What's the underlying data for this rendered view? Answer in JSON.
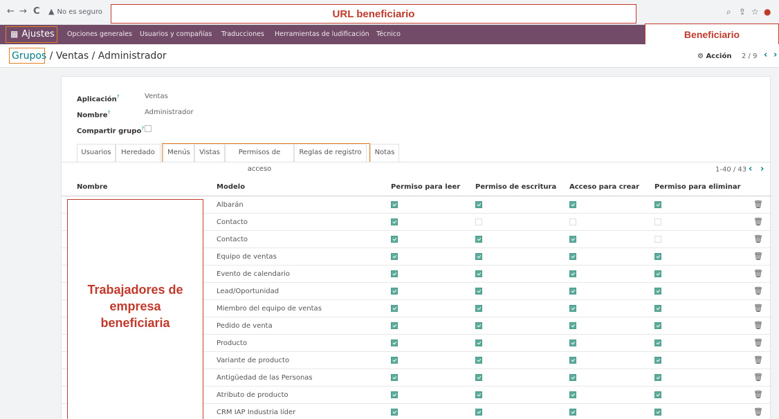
{
  "browser": {
    "back_icon": "←",
    "forward_icon": "→",
    "reload_icon": "C",
    "insecure_icon": "▲",
    "insecure_text": "No es seguro"
  },
  "annotations": {
    "url_label": "URL beneficiario",
    "beneficiary_label": "Beneficiario",
    "workers_label_line1": "Trabajadores de",
    "workers_label_line2": "empresa",
    "workers_label_line3": "beneficiaria",
    "highlight_color": "#c0392b",
    "focus_color": "#e67e22"
  },
  "navbar": {
    "app_icon": "▦",
    "app_name": "Ajustes",
    "menu": [
      "Opciones generales",
      "Usuarios y compañías",
      "Traducciones",
      "Herramientas de ludificación",
      "Técnico"
    ],
    "brand_color": "#714b67"
  },
  "breadcrumb": {
    "root": "Grupos",
    "rest": " / Ventas / Administrador"
  },
  "control": {
    "action_label": "⚙ Acción",
    "pager": "2 / 9",
    "prev": "‹",
    "next": "›"
  },
  "form": {
    "app_label": "Aplicación",
    "app_value": "Ventas",
    "name_label": "Nombre",
    "name_value": "Administrador",
    "share_label": "Compartir grupo",
    "help_mark": "?"
  },
  "tabs": [
    "Usuarios",
    "Heredado",
    "Menús",
    "Vistas",
    "Permisos de acceso",
    "Reglas de registro",
    "Notas"
  ],
  "list": {
    "pager": "1-40 / 43",
    "prev": "‹",
    "next": "›",
    "columns": [
      "Nombre",
      "Modelo",
      "Permiso para leer",
      "Permiso de escritura",
      "Acceso para crear",
      "Permiso para eliminar"
    ],
    "rows": [
      {
        "model": "Albarán",
        "read": true,
        "write": true,
        "create": true,
        "unlink": true
      },
      {
        "model": "Contacto",
        "read": true,
        "write": false,
        "create": false,
        "unlink": false
      },
      {
        "model": "Contacto",
        "read": true,
        "write": true,
        "create": true,
        "unlink": false
      },
      {
        "model": "Equipo de ventas",
        "read": true,
        "write": true,
        "create": true,
        "unlink": true
      },
      {
        "model": "Evento de calendario",
        "read": true,
        "write": true,
        "create": true,
        "unlink": true
      },
      {
        "model": "Lead/Oportunidad",
        "read": true,
        "write": true,
        "create": true,
        "unlink": true
      },
      {
        "model": "Miembro del equipo de ventas",
        "read": true,
        "write": true,
        "create": true,
        "unlink": true
      },
      {
        "model": "Pedido de venta",
        "read": true,
        "write": true,
        "create": true,
        "unlink": true
      },
      {
        "model": "Producto",
        "read": true,
        "write": true,
        "create": true,
        "unlink": true
      },
      {
        "model": "Variante de producto",
        "read": true,
        "write": true,
        "create": true,
        "unlink": true
      },
      {
        "model": "Antigüedad de las Personas",
        "read": true,
        "write": true,
        "create": true,
        "unlink": true
      },
      {
        "model": "Atributo de producto",
        "read": true,
        "write": true,
        "create": true,
        "unlink": true
      },
      {
        "model": "CRM IAP Industria líder",
        "read": true,
        "write": true,
        "create": true,
        "unlink": true
      }
    ],
    "trash_icon": "🗑"
  }
}
